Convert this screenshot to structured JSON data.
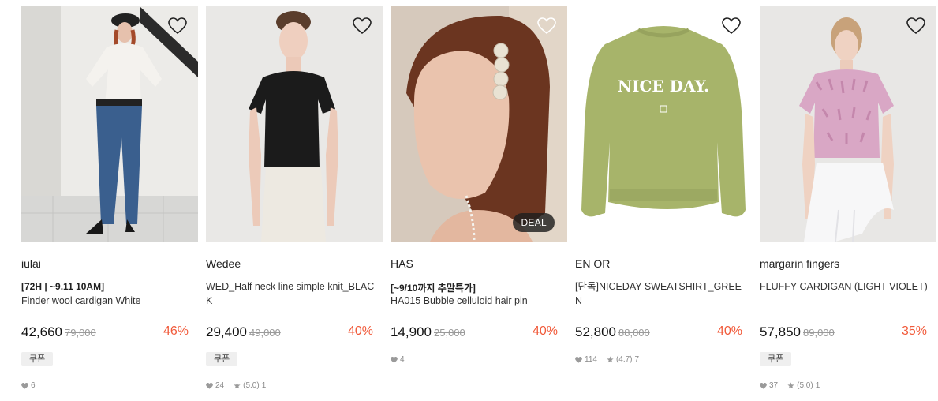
{
  "products": [
    {
      "brand": "iulai",
      "promo": "[72H | ~9.11 10AM]",
      "name": "Finder wool cardigan White",
      "price": "42,660",
      "original_price": "79,000",
      "discount": "46%",
      "coupon": "쿠폰",
      "likes": "6",
      "rating": "",
      "reviews": "",
      "badge": ""
    },
    {
      "brand": "Wedee",
      "promo": "",
      "name": "WED_Half neck line simple knit_BLACK",
      "price": "29,400",
      "original_price": "49,000",
      "discount": "40%",
      "coupon": "쿠폰",
      "likes": "24",
      "rating": "(5.0)",
      "reviews": "1",
      "badge": ""
    },
    {
      "brand": "HAS",
      "promo": "[~9/10까지 추말특가]",
      "name": "HA015 Bubble celluloid hair pin",
      "price": "14,900",
      "original_price": "25,000",
      "discount": "40%",
      "coupon": "",
      "likes": "4",
      "rating": "",
      "reviews": "",
      "badge": "DEAL"
    },
    {
      "brand": "EN OR",
      "promo": "",
      "name": "[단독]NICEDAY SWEATSHIRT_GREEN",
      "price": "52,800",
      "original_price": "88,000",
      "discount": "40%",
      "coupon": "",
      "likes": "114",
      "rating": "(4.7)",
      "reviews": "7",
      "badge": "",
      "print_text": "NICE DAY."
    },
    {
      "brand": "margarin fingers",
      "promo": "",
      "name": "FLUFFY CARDIGAN (LIGHT VIOLET)",
      "price": "57,850",
      "original_price": "89,000",
      "discount": "35%",
      "coupon": "쿠폰",
      "likes": "37",
      "rating": "(5.0)",
      "reviews": "1",
      "badge": ""
    }
  ],
  "colors": {
    "discount": "#f15a3a",
    "coupon_bg": "#efefef"
  }
}
